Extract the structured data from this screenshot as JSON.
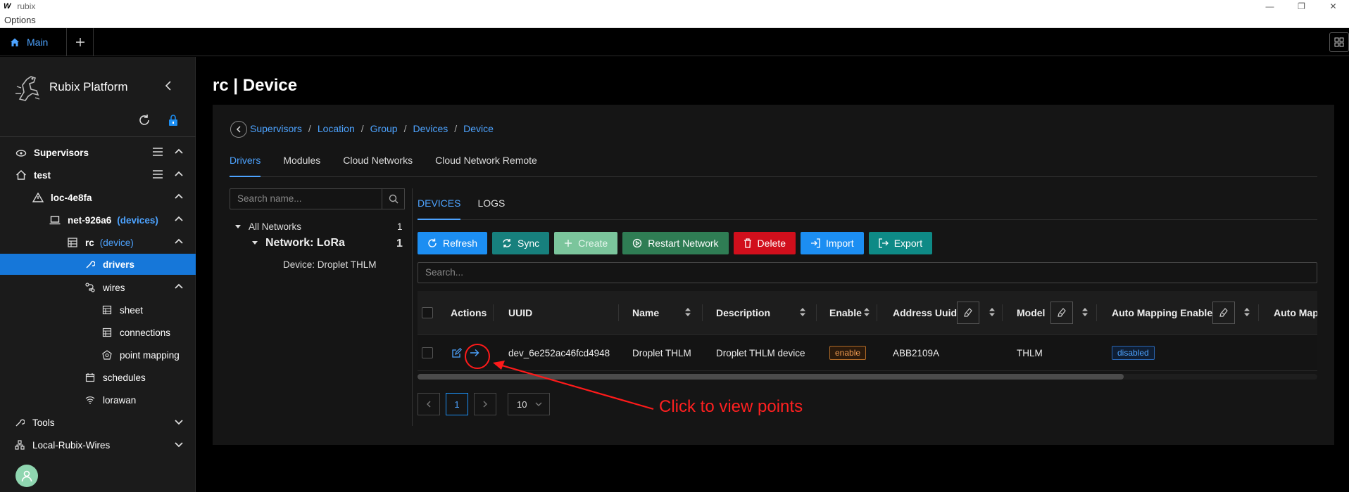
{
  "window": {
    "logo": "W",
    "title": "rubix",
    "menu": "Options"
  },
  "tabstrip": {
    "main_tab": "Main"
  },
  "sidebar": {
    "brand": "Rubix Platform",
    "items": [
      {
        "label": "Supervisors"
      },
      {
        "label": "test"
      },
      {
        "label": "loc-4e8fa"
      },
      {
        "label": "net-926a6",
        "tag": "(devices)"
      },
      {
        "label": "rc",
        "tag": "(device)"
      },
      {
        "label": "drivers"
      },
      {
        "label": "wires"
      },
      {
        "label": "sheet"
      },
      {
        "label": "connections"
      },
      {
        "label": "point mapping"
      },
      {
        "label": "schedules"
      },
      {
        "label": "lorawan"
      },
      {
        "label": "Tools"
      },
      {
        "label": "Local-Rubix-Wires"
      }
    ]
  },
  "page": {
    "title": "rc | Device",
    "breadcrumb": [
      "Supervisors",
      "Location",
      "Group",
      "Devices",
      "Device"
    ],
    "breadcrumb_sep": "/",
    "tabs": [
      "Drivers",
      "Modules",
      "Cloud Networks",
      "Cloud Network Remote"
    ]
  },
  "network_panel": {
    "search_placeholder": "Search name...",
    "all_networks": {
      "label": "All Networks",
      "count": "1"
    },
    "network": {
      "label": "Network: LoRa",
      "count": "1"
    },
    "device": "Device: Droplet THLM"
  },
  "devices": {
    "subtabs": [
      "DEVICES",
      "LOGS"
    ],
    "buttons": {
      "refresh": "Refresh",
      "sync": "Sync",
      "create": "Create",
      "restart": "Restart Network",
      "delete": "Delete",
      "import": "Import",
      "export": "Export"
    },
    "search_placeholder": "Search...",
    "columns": {
      "actions": "Actions",
      "uuid": "UUID",
      "name": "Name",
      "description": "Description",
      "enable": "Enable",
      "address_uuid": "Address Uuid",
      "model": "Model",
      "auto_mapping": "Auto Mapping Enable",
      "auto_map_cut": "Auto Map"
    },
    "row": {
      "uuid": "dev_6e252ac46fcd4948",
      "name": "Droplet THLM",
      "description": "Droplet THLM device",
      "enable": "enable",
      "address_uuid": "ABB2109A",
      "model": "THLM",
      "auto_mapping": "disabled"
    },
    "scroll_fraction": 0.785,
    "pager": {
      "current": "1",
      "page_size": "10"
    }
  },
  "annotation": {
    "text": "Click to view points",
    "color": "#ff2020"
  },
  "colors": {
    "accent": "#4da3ff",
    "primary_button": "#1c8ef2",
    "active_nav": "#1677d9",
    "danger": "#d10f1c"
  }
}
